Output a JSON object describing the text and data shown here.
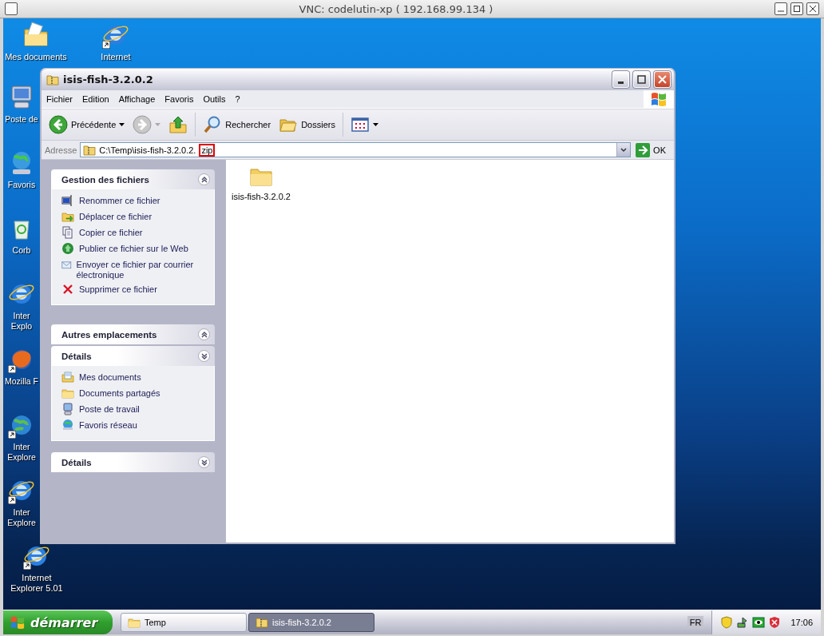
{
  "vnc_title": "VNC: codelutin-xp ( 192.168.99.134 )",
  "desktop": {
    "top_row": [
      {
        "kind": "documents",
        "shortcut": false,
        "lines": [
          "Mes documents"
        ]
      },
      {
        "kind": "ie",
        "shortcut": true,
        "lines": [
          "Internet"
        ]
      }
    ],
    "column": [
      {
        "kind": "computer",
        "shortcut": false,
        "lines": [
          "Poste de"
        ]
      },
      {
        "kind": "network",
        "shortcut": false,
        "lines": [
          "Favoris"
        ]
      },
      {
        "kind": "recycle",
        "shortcut": false,
        "lines": [
          "Corb"
        ]
      },
      {
        "kind": "ie",
        "shortcut": false,
        "lines": [
          "Inter",
          "Explo"
        ]
      },
      {
        "kind": "firefox",
        "shortcut": true,
        "lines": [
          "Mozilla F"
        ]
      },
      {
        "kind": "globe",
        "shortcut": true,
        "lines": [
          "Inter",
          "Explore"
        ]
      },
      {
        "kind": "ie",
        "shortcut": true,
        "lines": [
          "Inter",
          "Explore"
        ]
      },
      {
        "kind": "ie",
        "shortcut": true,
        "lines": [
          "Internet",
          "Explorer 5.01"
        ]
      }
    ]
  },
  "window": {
    "title": "isis-fish-3.2.0.2",
    "menu": [
      "Fichier",
      "Edition",
      "Affichage",
      "Favoris",
      "Outils",
      "?"
    ],
    "toolbar": [
      {
        "kind": "back",
        "label": "Précédente",
        "dropdown": true,
        "disabled": false
      },
      {
        "kind": "forward",
        "dropdown": true,
        "disabled": true
      },
      {
        "kind": "up",
        "dropdown": false,
        "disabled": false
      },
      {
        "kind": "search",
        "label": "Rechercher",
        "dropdown": false,
        "disabled": false
      },
      {
        "kind": "folders",
        "label": "Dossiers",
        "dropdown": false,
        "disabled": false
      },
      {
        "kind": "views",
        "dropdown": true,
        "disabled": false
      }
    ],
    "address": {
      "label": "Adresse",
      "path": "C:\\Temp\\isis-fish-3.2.0.2.",
      "highlighted": "zip",
      "go": "OK"
    },
    "panels": [
      {
        "title": "Gestion des fichiers",
        "expanded": true,
        "items": [
          {
            "kind": "rename",
            "label": "Renommer ce fichier"
          },
          {
            "kind": "move",
            "label": "Déplacer ce fichier"
          },
          {
            "kind": "copy",
            "label": "Copier ce fichier"
          },
          {
            "kind": "publish",
            "label": "Publier ce fichier sur le Web"
          },
          {
            "kind": "mail",
            "label": "Envoyer ce fichier par courrier électronique"
          },
          {
            "kind": "delete",
            "label": "Supprimer ce fichier"
          }
        ]
      },
      {
        "title": "Autres emplacements",
        "expanded": true
      },
      {
        "title": "Détails",
        "expanded": false,
        "items": [
          {
            "kind": "documents",
            "label": "Mes documents"
          },
          {
            "kind": "folder",
            "label": "Documents partagés"
          },
          {
            "kind": "computer",
            "label": "Poste de travail"
          },
          {
            "kind": "network",
            "label": "Favoris réseau"
          }
        ]
      },
      {
        "title": "Détails",
        "expanded": false
      }
    ],
    "files": [
      {
        "kind": "folder",
        "name": "isis-fish-3.2.0.2"
      }
    ]
  },
  "taskbar": {
    "start": "démarrer",
    "tasks": [
      {
        "kind": "folder",
        "label": "Temp",
        "selected": false
      },
      {
        "kind": "zip",
        "label": "isis-fish-3.2.0.2",
        "selected": true
      }
    ],
    "language": "FR",
    "clock": "17:06"
  }
}
